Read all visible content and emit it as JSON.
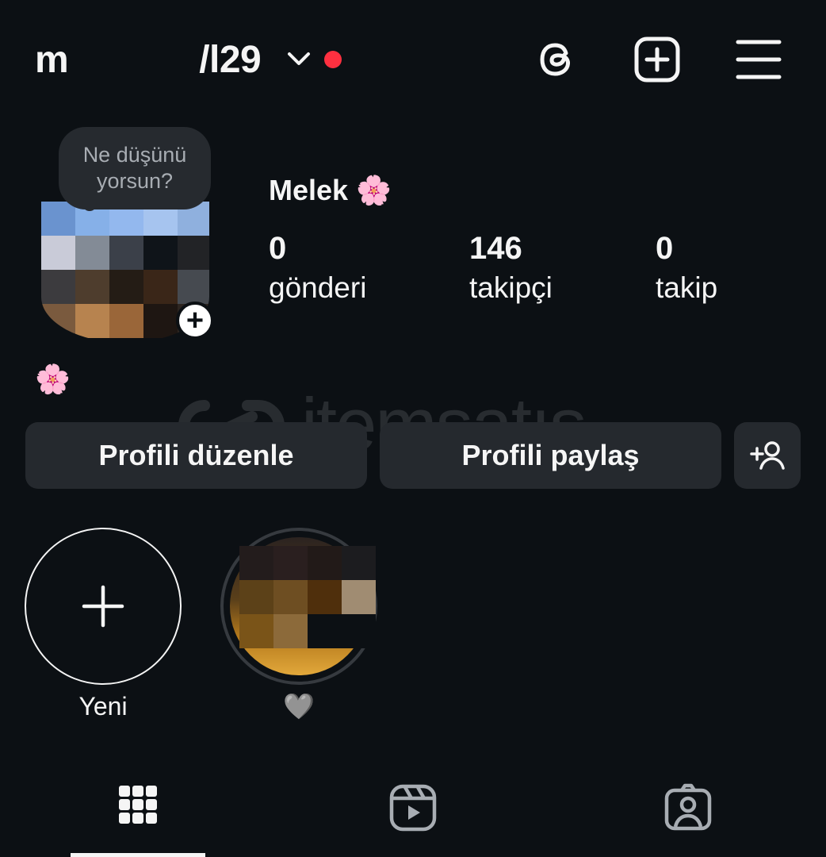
{
  "header": {
    "username_prefix": "m",
    "username_suffix": "/l29",
    "icons": [
      "chevron-down-icon",
      "threads-icon",
      "plus-square-icon",
      "menu-icon"
    ],
    "notification_dot_color": "#ff3040"
  },
  "profile": {
    "note_placeholder": "Ne düşünü yorsun?",
    "name": "Melek 🌸",
    "bio": "🌸",
    "stats": [
      {
        "value": "0",
        "label": "gönderi"
      },
      {
        "value": "146",
        "label": "takipçi"
      },
      {
        "value": "0",
        "label": "takip"
      }
    ]
  },
  "watermark": "itemsatıs",
  "buttons": {
    "edit_profile": "Profili düzenle",
    "share_profile": "Profili paylaş",
    "add_person_icon": "add-person-icon"
  },
  "highlights": [
    {
      "label": "Yeni",
      "icon": "plus-icon"
    },
    {
      "label": "🩶"
    }
  ],
  "tabs": [
    "grid-icon",
    "reels-icon",
    "tagged-icon"
  ],
  "colors": {
    "background": "#0c1014",
    "button": "#25292e",
    "text": "#f5f5f5"
  }
}
